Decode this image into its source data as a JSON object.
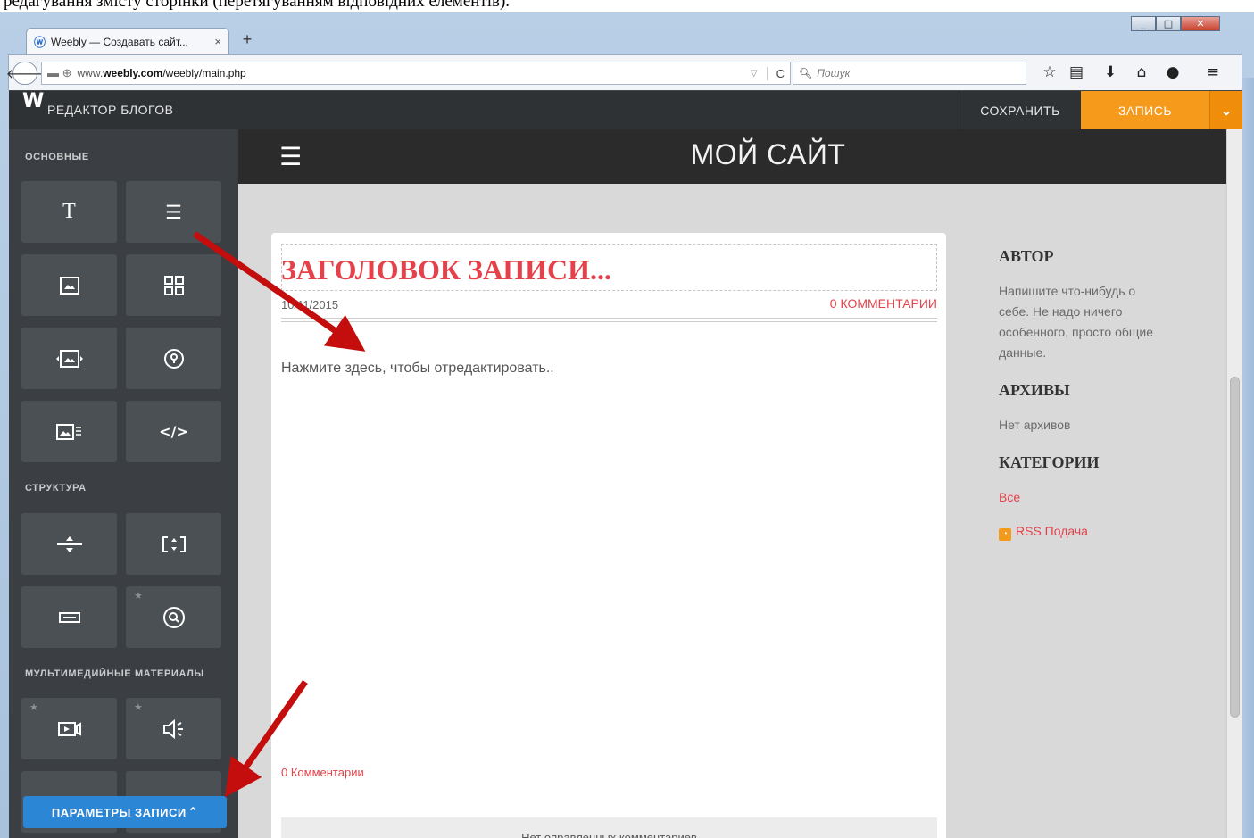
{
  "doc": {
    "text_above": "редагування змісту сторінки (перетягуванням відповідних елементів)."
  },
  "window": {
    "min": "_",
    "max": "□",
    "close": "✕"
  },
  "browser": {
    "tab_title": "Weebly — Создавать сайт...",
    "tab_close": "×",
    "new_tab": "+",
    "url_prefix": "www.",
    "url_domain": "weebly.com",
    "url_path": "/weebly/main.php",
    "search_placeholder": "Пошук",
    "icons": [
      "star-icon",
      "reading-list-icon",
      "download-icon",
      "home-icon",
      "chat-icon",
      "menu-icon"
    ]
  },
  "editor": {
    "logo": "W",
    "title": "РЕДАКТОР БЛОГОВ",
    "save_label": "СОХРАНИТЬ",
    "publish_label": "ЗАПИСЬ",
    "publish_dropdown": "⌄"
  },
  "sidebar": {
    "section_basic": "ОСНОВНЫЕ",
    "section_structure": "СТРУКТУРА",
    "section_media": "МУЛЬТИМЕДИЙНЫЕ МАТЕРИАЛЫ",
    "tiles": {
      "title": "T",
      "text": "☰",
      "code": "</>"
    },
    "params_label": "ПАРАМЕТРЫ ЗАПИСИ",
    "params_chevron": "⌃"
  },
  "site": {
    "title": "МОЙ САЙТ",
    "post_title": "ЗАГОЛОВОК ЗАПИСИ...",
    "post_date": "10/11/2015",
    "comments_top": "0 КОММЕНТАРИИ",
    "body_placeholder": "Нажмите здесь, чтобы отредактировать..",
    "comments_bottom": "0 Комментарии",
    "no_comments": "Нет оправленных комментариев",
    "aside": {
      "author_heading": "АВТОР",
      "author_text": "Напишите что-нибудь о себе. Не надо ничего особенного, просто общие данные.",
      "archives_heading": "АРХИВЫ",
      "archives_text": "Нет архивов",
      "categories_heading": "КАТЕГОРИИ",
      "categories_all": "Все",
      "rss_label": "RSS Подача"
    }
  },
  "colors": {
    "accent_red": "#e6414a",
    "publish_orange": "#f59a1a",
    "params_blue": "#2b87d6",
    "arrow_red": "#c40d0d"
  }
}
